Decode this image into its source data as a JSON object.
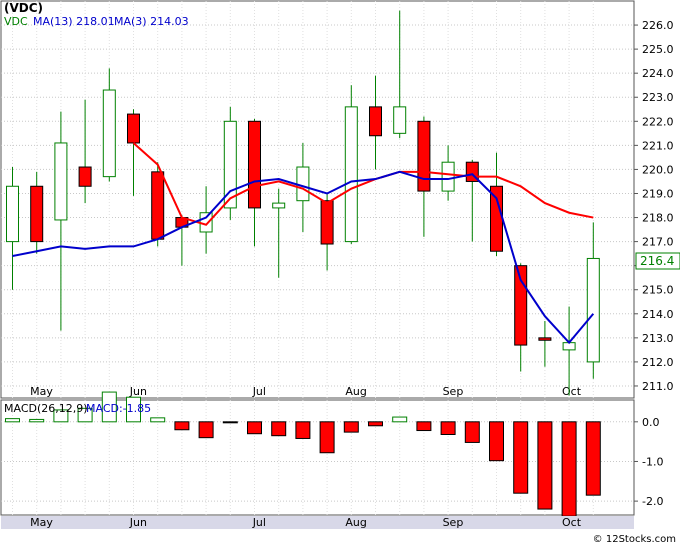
{
  "chart_data": {
    "type": "candlestick",
    "symbol": "(VDC)",
    "price_panel": {
      "legend": [
        {
          "name": "VDC",
          "color": "#008000"
        },
        {
          "name": "MA(13)",
          "value": "218.01",
          "color": "#0000cc"
        },
        {
          "name": "MA(3)",
          "value": "214.03",
          "color": "#0000cc"
        }
      ],
      "ylim": [
        210.5,
        227.0
      ],
      "yticks": [
        211.0,
        212.0,
        213.0,
        214.0,
        215.0,
        216.0,
        217.0,
        218.0,
        219.0,
        220.0,
        221.0,
        222.0,
        223.0,
        224.0,
        225.0,
        226.0
      ],
      "last_price": "216.4",
      "candles": [
        {
          "o": 217.0,
          "h": 220.1,
          "l": 215.0,
          "c": 219.3
        },
        {
          "o": 219.3,
          "h": 219.9,
          "l": 216.5,
          "c": 217.0
        },
        {
          "o": 217.9,
          "h": 222.4,
          "l": 213.3,
          "c": 221.1
        },
        {
          "o": 220.1,
          "h": 222.9,
          "l": 218.6,
          "c": 219.3
        },
        {
          "o": 219.7,
          "h": 224.2,
          "l": 219.5,
          "c": 223.3
        },
        {
          "o": 222.3,
          "h": 222.5,
          "l": 218.9,
          "c": 221.1
        },
        {
          "o": 219.9,
          "h": 220.3,
          "l": 216.8,
          "c": 217.1
        },
        {
          "o": 218.0,
          "h": 218.1,
          "l": 216.0,
          "c": 217.6
        },
        {
          "o": 217.4,
          "h": 219.3,
          "l": 216.5,
          "c": 218.2
        },
        {
          "o": 218.4,
          "h": 222.6,
          "l": 217.9,
          "c": 222.0
        },
        {
          "o": 222.0,
          "h": 222.1,
          "l": 216.8,
          "c": 218.4
        },
        {
          "o": 218.4,
          "h": 219.2,
          "l": 215.5,
          "c": 218.6
        },
        {
          "o": 218.7,
          "h": 221.1,
          "l": 217.4,
          "c": 220.1
        },
        {
          "o": 218.7,
          "h": 219.0,
          "l": 215.8,
          "c": 216.9
        },
        {
          "o": 217.0,
          "h": 223.5,
          "l": 216.9,
          "c": 222.6
        },
        {
          "o": 222.6,
          "h": 223.9,
          "l": 220.0,
          "c": 221.4
        },
        {
          "o": 221.5,
          "h": 226.6,
          "l": 221.3,
          "c": 222.6
        },
        {
          "o": 222.0,
          "h": 222.2,
          "l": 217.2,
          "c": 219.1
        },
        {
          "o": 219.1,
          "h": 221.0,
          "l": 218.7,
          "c": 220.3
        },
        {
          "o": 220.3,
          "h": 220.4,
          "l": 217.0,
          "c": 219.5
        },
        {
          "o": 219.3,
          "h": 220.7,
          "l": 216.4,
          "c": 216.6
        },
        {
          "o": 216.0,
          "h": 216.1,
          "l": 211.6,
          "c": 212.7
        },
        {
          "o": 213.0,
          "h": 213.7,
          "l": 211.8,
          "c": 212.9
        },
        {
          "o": 212.5,
          "h": 214.3,
          "l": 210.6,
          "c": 212.8
        },
        {
          "o": 212.0,
          "h": 217.8,
          "l": 211.3,
          "c": 216.3
        }
      ],
      "ma_red": [
        221.1,
        220.7,
        219.9,
        219.2,
        218.3,
        218.9,
        219.5,
        219.7,
        219.8,
        219.8,
        219.8,
        219.2,
        218.6,
        218.2,
        218.0
      ],
      "ma_blue": [
        216.4,
        216.6,
        216.7,
        216.6,
        216.7,
        216.7,
        217.3,
        217.8,
        218.5,
        219.5,
        219.7,
        219.3,
        218.7,
        219.3,
        219.9,
        220.4,
        222.2,
        221.5,
        219.6,
        219.7,
        219.8,
        218.7,
        215.4,
        214.0,
        212.9,
        214.0
      ]
    },
    "macd_panel": {
      "legend": [
        {
          "name": "MACD(26,12,9)",
          "color": "#000000"
        },
        {
          "name": "MACD:",
          "value": "-1.85",
          "color": "#0000cc"
        }
      ],
      "ylim": [
        -2.35,
        0.55
      ],
      "yticks": [
        0.0,
        -1.0,
        -2.0
      ],
      "ytick_labels": [
        "0.0",
        "-1.0",
        "-2.0"
      ],
      "values": [
        0.08,
        0.06,
        0.3,
        0.34,
        0.75,
        0.62,
        0.1,
        -0.2,
        -0.4,
        -0.02,
        -0.3,
        -0.35,
        -0.42,
        -0.78,
        -0.26,
        -0.1,
        0.12,
        -0.22,
        -0.32,
        -0.52,
        -0.98,
        -1.8,
        -2.2,
        -2.38,
        -1.85
      ]
    },
    "x_months": [
      {
        "label": "May",
        "idx": 1.2
      },
      {
        "label": "Jun",
        "idx": 5.2
      },
      {
        "label": "Jul",
        "idx": 10.2
      },
      {
        "label": "Aug",
        "idx": 14.2
      },
      {
        "label": "Sep",
        "idx": 18.2
      },
      {
        "label": "Oct",
        "idx": 23.1
      }
    ],
    "grid": true,
    "attribution": "© 12Stocks.com"
  }
}
